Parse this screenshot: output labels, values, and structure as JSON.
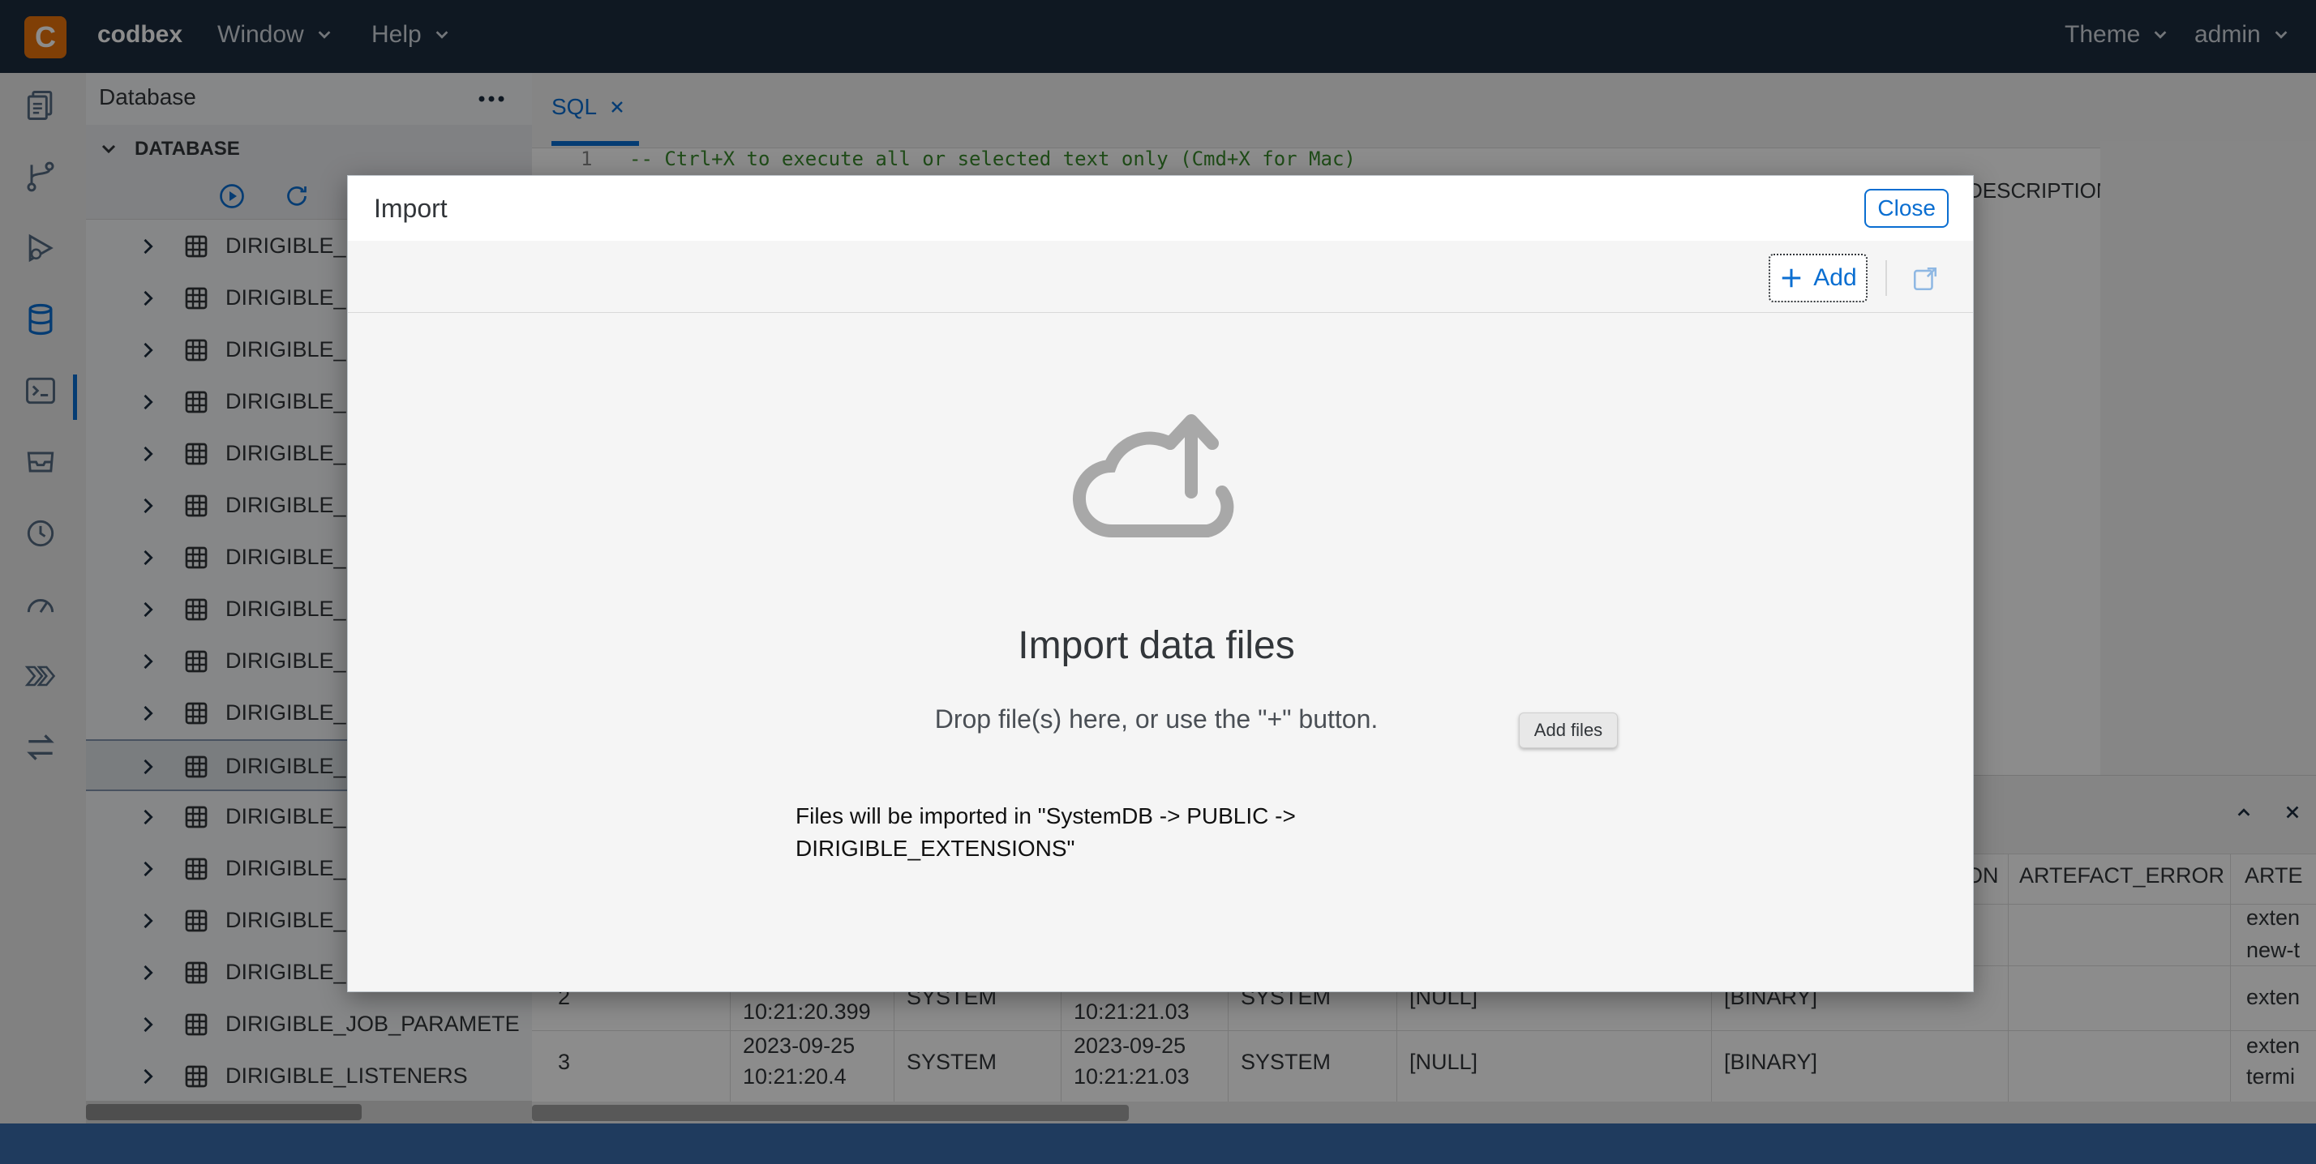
{
  "app": {
    "logo_letter": "C",
    "brand": "codbex"
  },
  "topbar": {
    "menus": [
      "Window",
      "Help"
    ],
    "right_menus": [
      "Theme",
      "admin"
    ]
  },
  "activity_bar": {
    "icons": [
      "documents-icon",
      "git-branch-icon",
      "debug-icon",
      "database-icon",
      "terminal-icon",
      "inbox-icon",
      "history-icon",
      "gauge-icon",
      "chevrons-icon",
      "transfer-icon"
    ],
    "active": "database-icon"
  },
  "db_panel": {
    "title": "Database",
    "section": "DATABASE",
    "tree_items": [
      "DIRIGIBLE_",
      "DIRIGIBLE_",
      "DIRIGIBLE_",
      "DIRIGIBLE_",
      "DIRIGIBLE_",
      "DIRIGIBLE_",
      "DIRIGIBLE_",
      "DIRIGIBLE_",
      "DIRIGIBLE_",
      "DIRIGIBLE_",
      "DIRIGIBLE_",
      "DIRIGIBLE_",
      "DIRIGIBLE_",
      "DIRIGIBLE_",
      "DIRIGIBLE_",
      "DIRIGIBLE_JOB_PARAMETE",
      "DIRIGIBLE_LISTENERS"
    ],
    "selected_index": 10
  },
  "editor": {
    "tab_label": "SQL",
    "line_number": "1",
    "code_line": "-- Ctrl+X to execute all or selected text only (Cmd+X for Mac)",
    "column_header_top": "DESCRIPTION"
  },
  "results": {
    "headers": [
      "ON",
      "ARTEFACT_ERROR",
      "ARTE"
    ],
    "rows": [
      {
        "num": "",
        "c1a": "",
        "c1b": "",
        "c2": "",
        "c3a": "",
        "c3b": "",
        "c4": "",
        "c5": "",
        "c6": "",
        "c8a": "exten",
        "c8b": "new-t"
      },
      {
        "num": "2",
        "c1a": "",
        "c1b": "10:21:20.399",
        "c2": "SYSTEM",
        "c3a": "",
        "c3b": "10:21:21.03",
        "c4": "SYSTEM",
        "c5": "[NULL]",
        "c6": "[BINARY]",
        "c8a": "exten",
        "c8b": ""
      },
      {
        "num": "3",
        "c1a": "2023-09-25",
        "c1b": "10:21:20.4",
        "c2": "SYSTEM",
        "c3a": "2023-09-25",
        "c3b": "10:21:21.03",
        "c4": "SYSTEM",
        "c5": "[NULL]",
        "c6": "[BINARY]",
        "c8a": "exten",
        "c8b": "termi"
      }
    ]
  },
  "dialog": {
    "title": "Import",
    "close_label": "Close",
    "add_label": "Add",
    "heading": "Import data files",
    "drop_message": "Drop file(s) here, or use the \"+\" button.",
    "add_files_tooltip": "Add files",
    "note_line1": "Files will be imported in \"SystemDB -> PUBLIC ->",
    "note_line2": "DIRIGIBLE_EXTENSIONS\""
  },
  "colors": {
    "topbar": "#1d2d3e",
    "accent": "#0a6ed1",
    "logo": "#e9730c",
    "statusbar": "#1f3b5e"
  }
}
